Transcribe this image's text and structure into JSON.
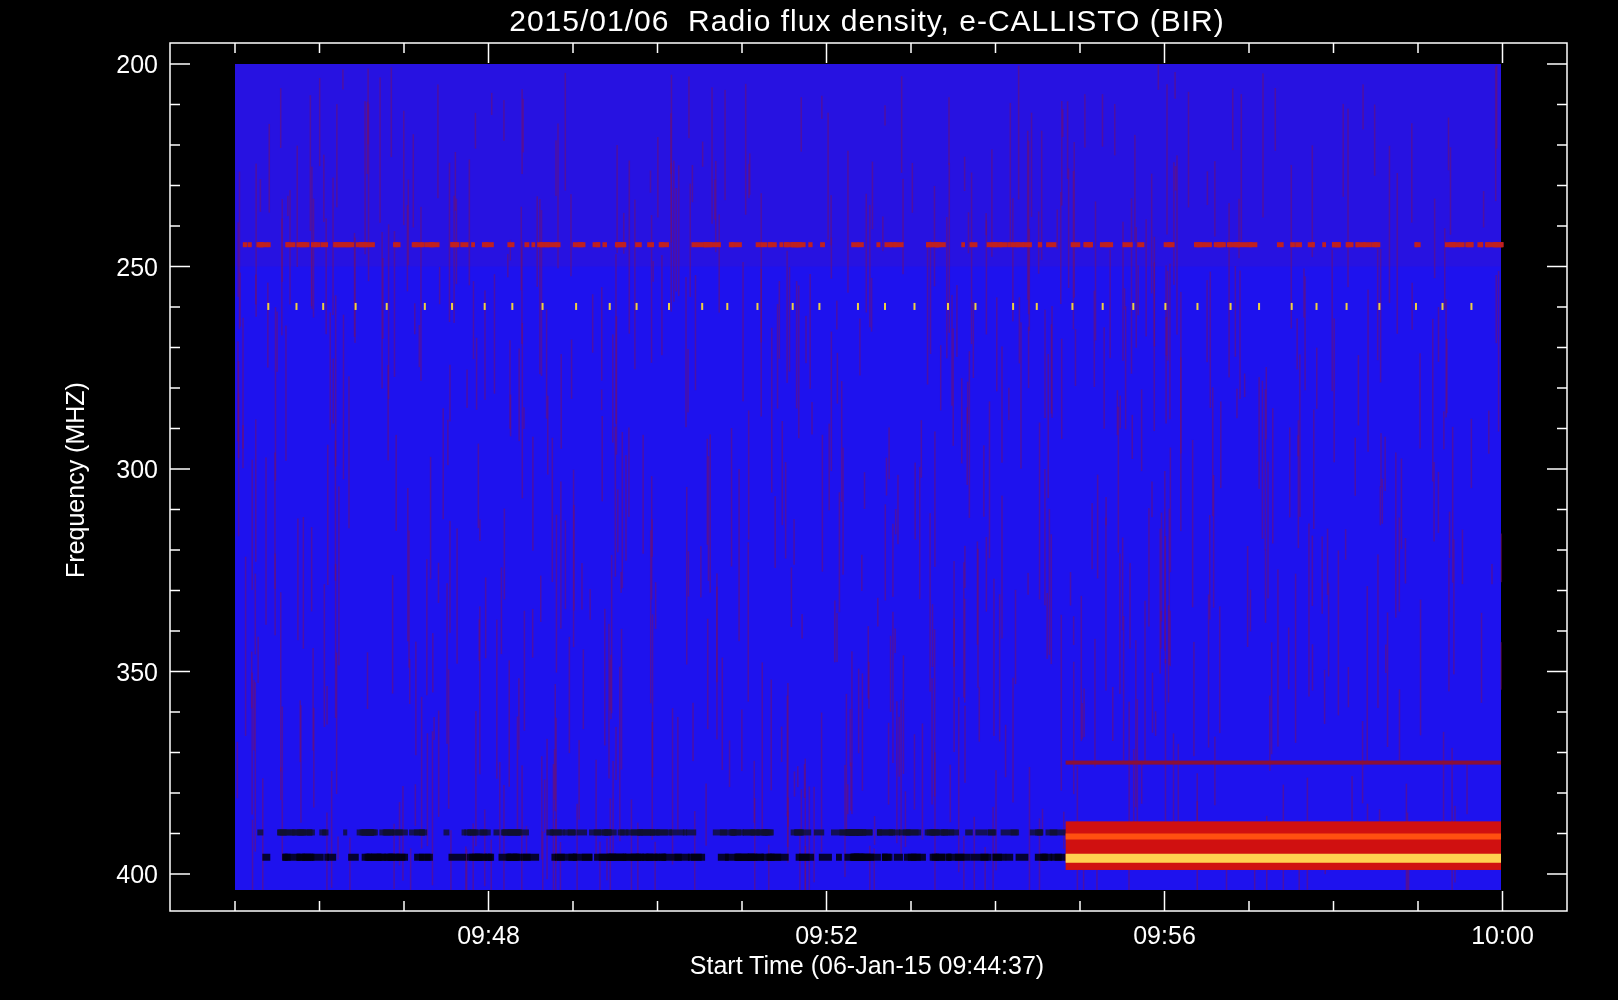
{
  "title": "2015/01/06  Radio flux density, e-CALLISTO (BIR)",
  "y_axis": {
    "label": "Frequency (MHZ)",
    "ticks": [
      "200",
      "250",
      "300",
      "350",
      "400"
    ]
  },
  "x_axis": {
    "label": "Start Time (06-Jan-15 09:44:37)",
    "ticks": [
      "09:48",
      "09:52",
      "09:56",
      "10:00"
    ]
  }
}
